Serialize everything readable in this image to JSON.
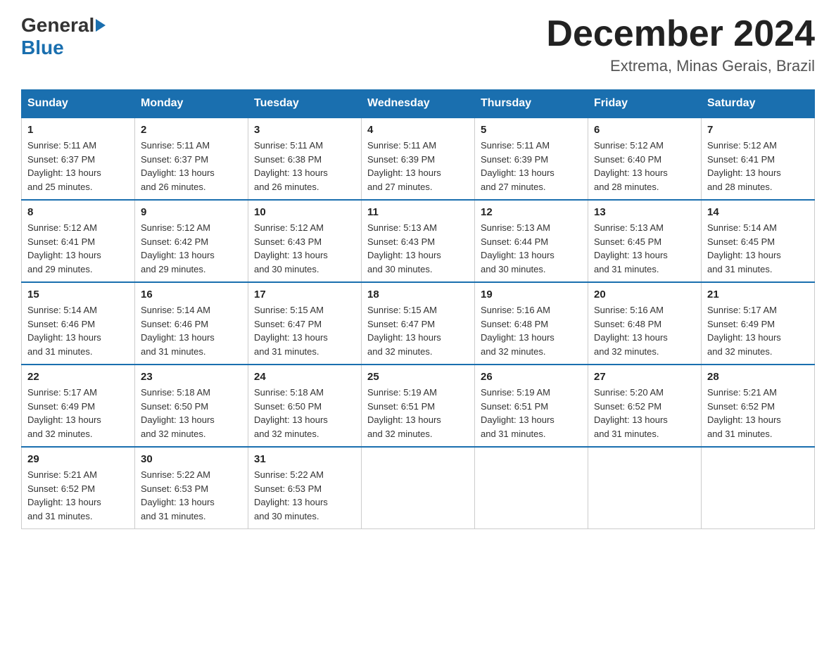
{
  "header": {
    "logo_general": "General",
    "logo_blue": "Blue",
    "month_title": "December 2024",
    "subtitle": "Extrema, Minas Gerais, Brazil"
  },
  "days_of_week": [
    "Sunday",
    "Monday",
    "Tuesday",
    "Wednesday",
    "Thursday",
    "Friday",
    "Saturday"
  ],
  "weeks": [
    [
      {
        "day": "1",
        "sunrise": "5:11 AM",
        "sunset": "6:37 PM",
        "daylight": "13 hours and 25 minutes."
      },
      {
        "day": "2",
        "sunrise": "5:11 AM",
        "sunset": "6:37 PM",
        "daylight": "13 hours and 26 minutes."
      },
      {
        "day": "3",
        "sunrise": "5:11 AM",
        "sunset": "6:38 PM",
        "daylight": "13 hours and 26 minutes."
      },
      {
        "day": "4",
        "sunrise": "5:11 AM",
        "sunset": "6:39 PM",
        "daylight": "13 hours and 27 minutes."
      },
      {
        "day": "5",
        "sunrise": "5:11 AM",
        "sunset": "6:39 PM",
        "daylight": "13 hours and 27 minutes."
      },
      {
        "day": "6",
        "sunrise": "5:12 AM",
        "sunset": "6:40 PM",
        "daylight": "13 hours and 28 minutes."
      },
      {
        "day": "7",
        "sunrise": "5:12 AM",
        "sunset": "6:41 PM",
        "daylight": "13 hours and 28 minutes."
      }
    ],
    [
      {
        "day": "8",
        "sunrise": "5:12 AM",
        "sunset": "6:41 PM",
        "daylight": "13 hours and 29 minutes."
      },
      {
        "day": "9",
        "sunrise": "5:12 AM",
        "sunset": "6:42 PM",
        "daylight": "13 hours and 29 minutes."
      },
      {
        "day": "10",
        "sunrise": "5:12 AM",
        "sunset": "6:43 PM",
        "daylight": "13 hours and 30 minutes."
      },
      {
        "day": "11",
        "sunrise": "5:13 AM",
        "sunset": "6:43 PM",
        "daylight": "13 hours and 30 minutes."
      },
      {
        "day": "12",
        "sunrise": "5:13 AM",
        "sunset": "6:44 PM",
        "daylight": "13 hours and 30 minutes."
      },
      {
        "day": "13",
        "sunrise": "5:13 AM",
        "sunset": "6:45 PM",
        "daylight": "13 hours and 31 minutes."
      },
      {
        "day": "14",
        "sunrise": "5:14 AM",
        "sunset": "6:45 PM",
        "daylight": "13 hours and 31 minutes."
      }
    ],
    [
      {
        "day": "15",
        "sunrise": "5:14 AM",
        "sunset": "6:46 PM",
        "daylight": "13 hours and 31 minutes."
      },
      {
        "day": "16",
        "sunrise": "5:14 AM",
        "sunset": "6:46 PM",
        "daylight": "13 hours and 31 minutes."
      },
      {
        "day": "17",
        "sunrise": "5:15 AM",
        "sunset": "6:47 PM",
        "daylight": "13 hours and 31 minutes."
      },
      {
        "day": "18",
        "sunrise": "5:15 AM",
        "sunset": "6:47 PM",
        "daylight": "13 hours and 32 minutes."
      },
      {
        "day": "19",
        "sunrise": "5:16 AM",
        "sunset": "6:48 PM",
        "daylight": "13 hours and 32 minutes."
      },
      {
        "day": "20",
        "sunrise": "5:16 AM",
        "sunset": "6:48 PM",
        "daylight": "13 hours and 32 minutes."
      },
      {
        "day": "21",
        "sunrise": "5:17 AM",
        "sunset": "6:49 PM",
        "daylight": "13 hours and 32 minutes."
      }
    ],
    [
      {
        "day": "22",
        "sunrise": "5:17 AM",
        "sunset": "6:49 PM",
        "daylight": "13 hours and 32 minutes."
      },
      {
        "day": "23",
        "sunrise": "5:18 AM",
        "sunset": "6:50 PM",
        "daylight": "13 hours and 32 minutes."
      },
      {
        "day": "24",
        "sunrise": "5:18 AM",
        "sunset": "6:50 PM",
        "daylight": "13 hours and 32 minutes."
      },
      {
        "day": "25",
        "sunrise": "5:19 AM",
        "sunset": "6:51 PM",
        "daylight": "13 hours and 32 minutes."
      },
      {
        "day": "26",
        "sunrise": "5:19 AM",
        "sunset": "6:51 PM",
        "daylight": "13 hours and 31 minutes."
      },
      {
        "day": "27",
        "sunrise": "5:20 AM",
        "sunset": "6:52 PM",
        "daylight": "13 hours and 31 minutes."
      },
      {
        "day": "28",
        "sunrise": "5:21 AM",
        "sunset": "6:52 PM",
        "daylight": "13 hours and 31 minutes."
      }
    ],
    [
      {
        "day": "29",
        "sunrise": "5:21 AM",
        "sunset": "6:52 PM",
        "daylight": "13 hours and 31 minutes."
      },
      {
        "day": "30",
        "sunrise": "5:22 AM",
        "sunset": "6:53 PM",
        "daylight": "13 hours and 31 minutes."
      },
      {
        "day": "31",
        "sunrise": "5:22 AM",
        "sunset": "6:53 PM",
        "daylight": "13 hours and 30 minutes."
      },
      null,
      null,
      null,
      null
    ]
  ],
  "labels": {
    "sunrise": "Sunrise:",
    "sunset": "Sunset:",
    "daylight": "Daylight:"
  }
}
